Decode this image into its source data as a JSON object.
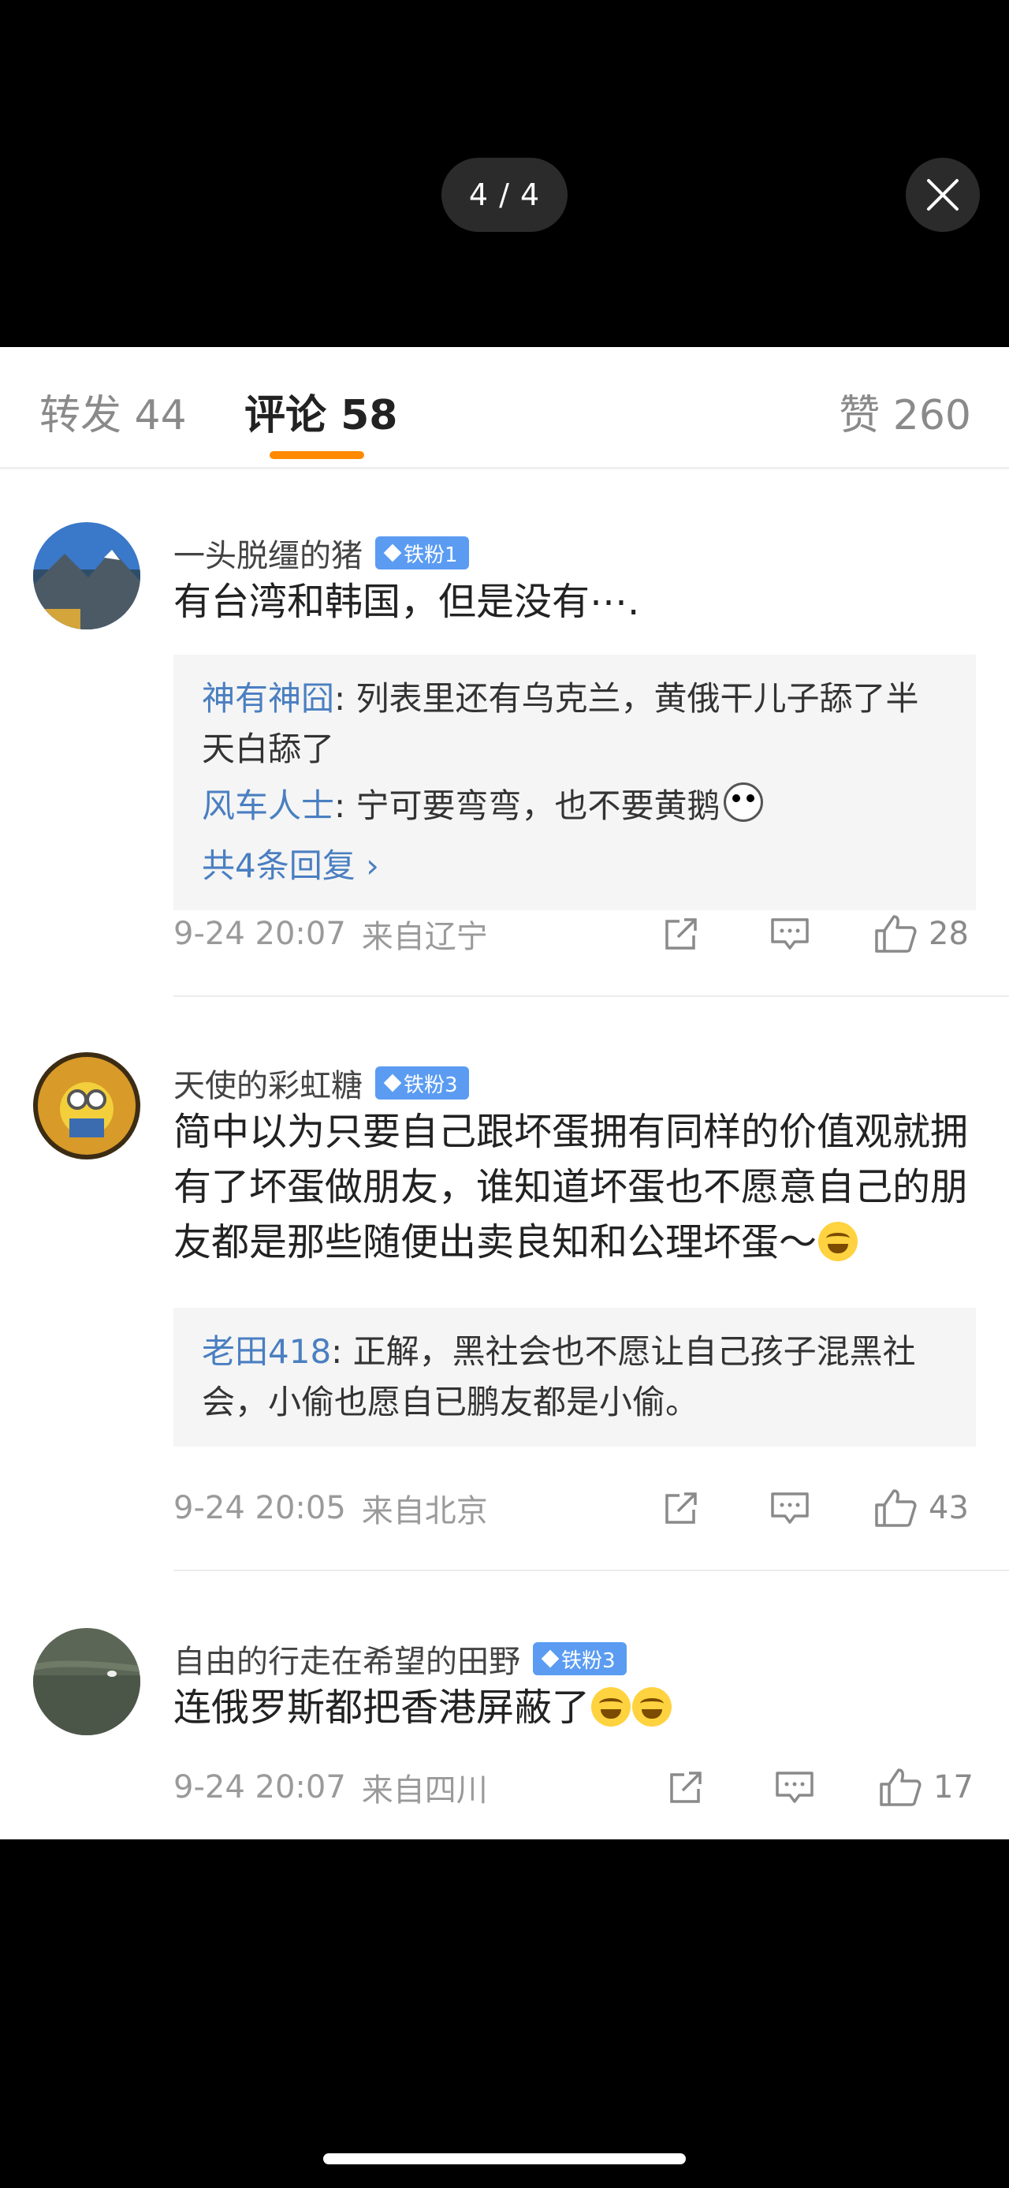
{
  "viewer": {
    "page_counter": "4 / 4"
  },
  "tabs": {
    "repost": "转发 44",
    "comments": "评论 58",
    "likes": "赞 260"
  },
  "comments": [
    {
      "username": "一头脱缰的猪",
      "badge": "铁粉1",
      "text": "有台湾和韩国，但是没有⋯.",
      "replies": [
        {
          "user": "神有神囧",
          "text": ": 列表里还有乌克兰，黄俄干儿子舔了半天白舔了"
        },
        {
          "user": "风车人士",
          "text": ": 宁可要弯弯，也不要黄鹅"
        }
      ],
      "more_replies": "共4条回复 ›",
      "time": "9-24 20:07",
      "location": "来自辽宁",
      "likes": "28"
    },
    {
      "username": "天使的彩虹糖",
      "badge": "铁粉3",
      "text": "简中以为只要自己跟坏蛋拥有同样的价值观就拥有了坏蛋做朋友，谁知道坏蛋也不愿意自己的朋友都是那些随便出卖良知和公理坏蛋～",
      "replies": [
        {
          "user": "老田418",
          "text": ": 正解，黑社会也不愿让自己孩子混黑社会，小偷也愿自已鹏友都是小偷。"
        }
      ],
      "time": "9-24 20:05",
      "location": "来自北京",
      "likes": "43"
    },
    {
      "username": "自由的行走在希望的田野",
      "badge": "铁粉3",
      "text": "连俄罗斯都把香港屏蔽了",
      "time": "9-24 20:07",
      "location": "来自四川",
      "likes": "17"
    }
  ]
}
